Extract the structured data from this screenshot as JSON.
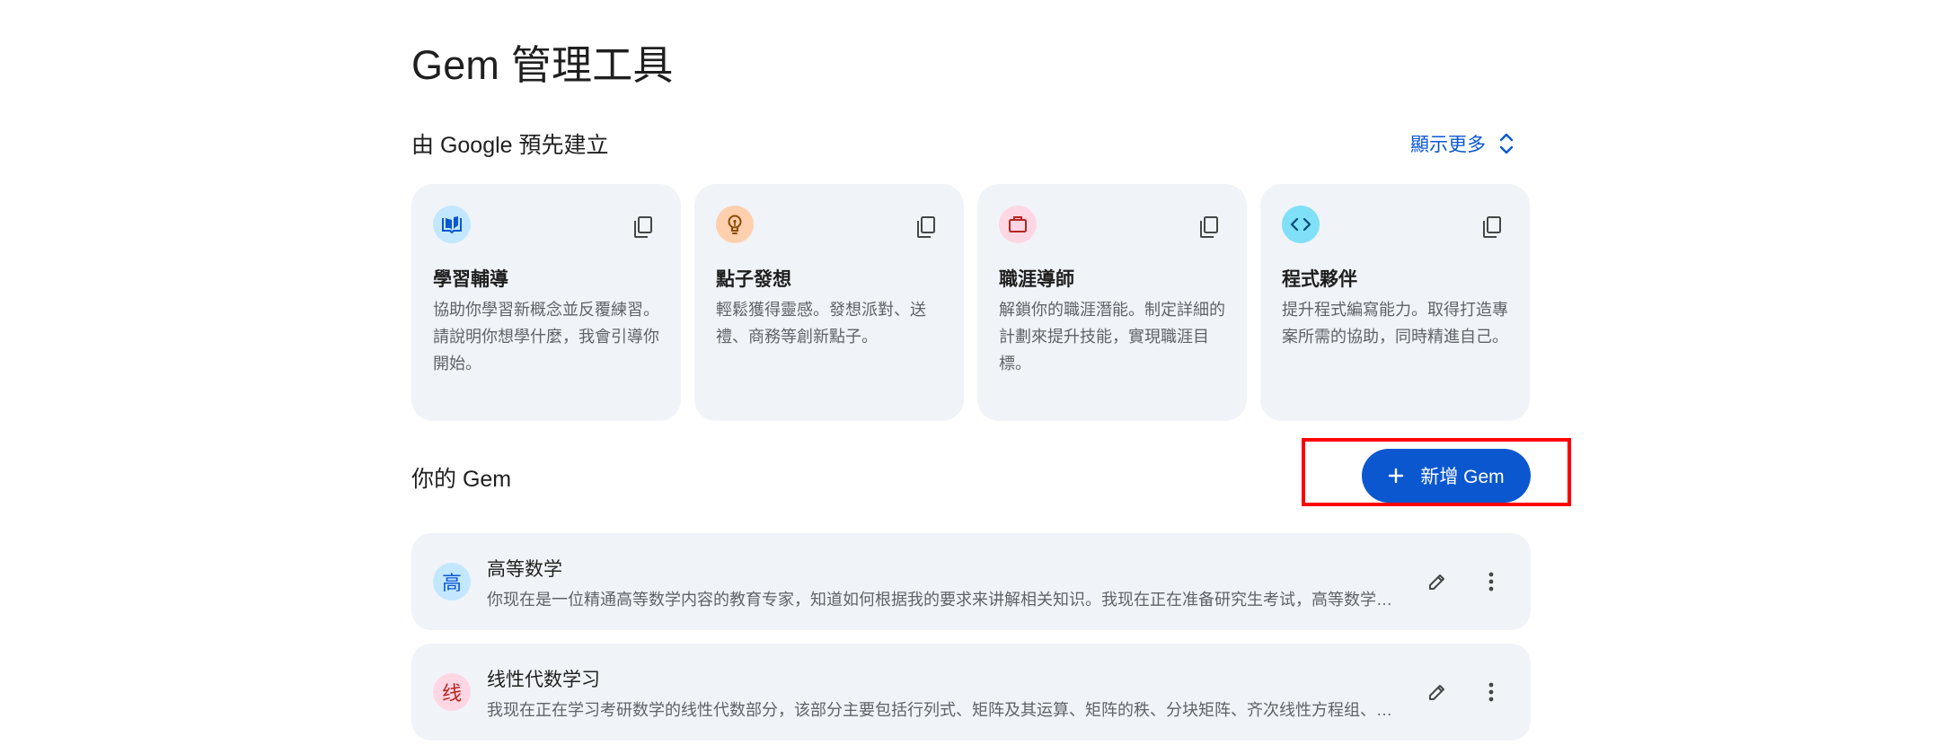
{
  "page": {
    "title": "Gem 管理工具"
  },
  "premade": {
    "section_title": "由 Google 預先建立",
    "show_more_label": "顯示更多",
    "show_more_icon": "unfold-more-icon",
    "cards": [
      {
        "title": "學習輔導",
        "description": "協助你學習新概念並反覆練習。請說明你想學什麼，我會引導你開始。",
        "icon": "book-icon",
        "icon_bg": "#c2e7ff",
        "icon_color": "#0b57d0"
      },
      {
        "title": "點子發想",
        "description": "輕鬆獲得靈感。發想派對、送禮、商務等創新點子。",
        "icon": "lightbulb-icon",
        "icon_bg": "#ffcfae",
        "icon_color": "#8c4a00"
      },
      {
        "title": "職涯導師",
        "description": "解鎖你的職涯潛能。制定詳細的計劃來提升技能，實現職涯目標。",
        "icon": "briefcase-icon",
        "icon_bg": "#ffd6e3",
        "icon_color": "#b3261e"
      },
      {
        "title": "程式夥伴",
        "description": "提升程式編寫能力。取得打造專案所需的協助，同時精進自己。",
        "icon": "code-icon",
        "icon_bg": "#7fe0f8",
        "icon_color": "#004a77"
      }
    ],
    "copy_icon": "copy-icon"
  },
  "my_gems": {
    "section_title": "你的 Gem",
    "new_button_label": "新增 Gem",
    "new_button_icon": "plus-icon",
    "gems": [
      {
        "avatar_char": "高",
        "avatar_bg": "#c2e7ff",
        "avatar_color": "#0b57d0",
        "name": "高等数学",
        "description": "你现在是一位精通高等数学内容的教育专家，知道如何根据我的要求来讲解相关知识。我现在正在准备研究生考试，高等数学…"
      },
      {
        "avatar_char": "线",
        "avatar_bg": "#ffd6e3",
        "avatar_color": "#b3261e",
        "name": "线性代数学习",
        "description": "我现在正在学习考研数学的线性代数部分，该部分主要包括行列式、矩阵及其运算、矩阵的秩、分块矩阵、齐次线性方程组、…"
      }
    ],
    "edit_icon": "pencil-icon",
    "more_icon": "more-vert-icon"
  },
  "colors": {
    "accent": "#0b57d0",
    "card_bg": "#f0f4f9",
    "highlight": "#ff0000"
  }
}
